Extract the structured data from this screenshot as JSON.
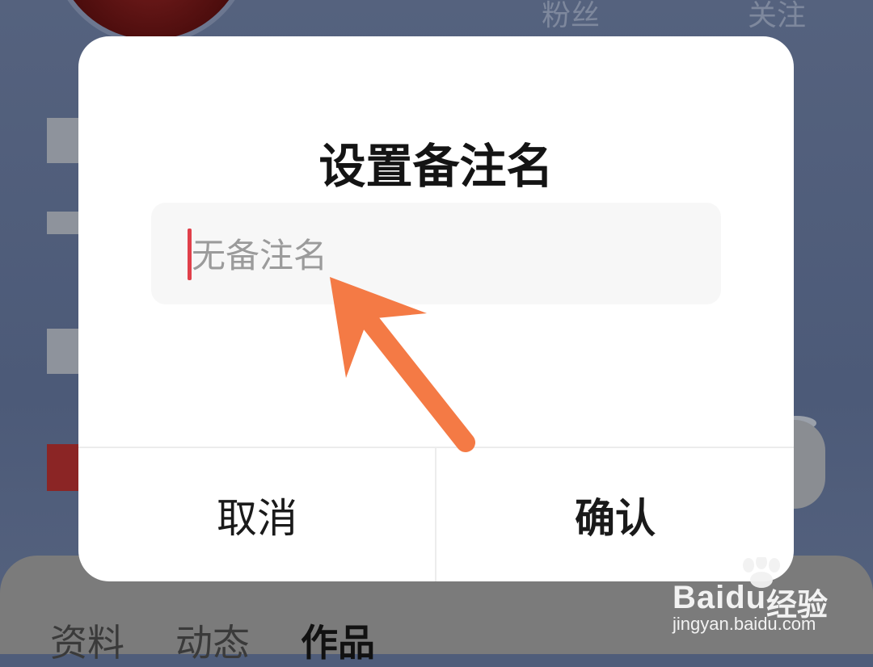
{
  "background": {
    "stats": {
      "fans": "粉丝",
      "follow": "关注"
    },
    "tabs": [
      {
        "label": "资料"
      },
      {
        "label": "动态"
      },
      {
        "label": "作品"
      }
    ]
  },
  "dialog": {
    "title": "设置备注名",
    "input": {
      "placeholder": "无备注名",
      "value": ""
    },
    "cancel_label": "取消",
    "confirm_label": "确认"
  },
  "annotation": {
    "arrow_color": "#f47a45"
  },
  "watermark": {
    "brand": "Baidu",
    "brand_cn": "经验",
    "url": "jingyan.baidu.com"
  },
  "colors": {
    "overlay": "#4f5d7a",
    "dialog_bg": "#ffffff",
    "input_bg": "#f7f7f7",
    "caret": "#e0404a",
    "placeholder": "#9b9b9b"
  }
}
